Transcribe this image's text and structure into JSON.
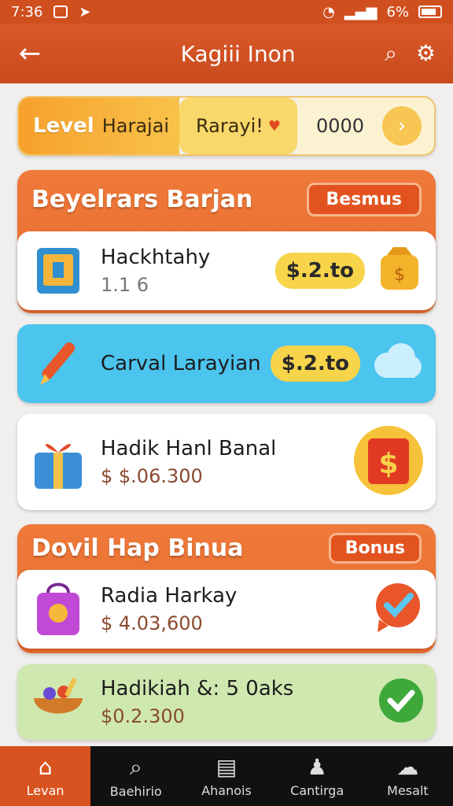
{
  "status_bar": {
    "time": "7:36",
    "battery": "6%"
  },
  "app_bar": {
    "back_icon": "back-arrow",
    "title": "Kagiii Inon",
    "search_icon": "search",
    "settings_icon": "gear"
  },
  "level_bar": {
    "level_label": "Level",
    "level_value": "Harajai",
    "middle_label": "Rarayi!",
    "count": "0000"
  },
  "section1": {
    "title": "Beyelrars Barjan",
    "button_label": "Besmus",
    "rows": [
      {
        "name": "Hackhtahy",
        "sub": "1.1 6",
        "price": "$.2.to"
      },
      {
        "name": "Carval Larayian",
        "price": "$.2.to"
      },
      {
        "name": "Hadik Hanl Banal",
        "sub": "$ $.06.300"
      }
    ]
  },
  "section2": {
    "title": "Dovil Hap Binua",
    "button_label": "Bonus",
    "rows": [
      {
        "name": "Radia Harkay",
        "sub": "$ 4.03,600"
      },
      {
        "name": "Hadikiah &: 5 0aks",
        "sub": "$0.2.300"
      }
    ]
  },
  "bottom_nav": [
    {
      "label": "Levan",
      "icon": "home",
      "active": true
    },
    {
      "label": "Baehirio",
      "icon": "search",
      "active": false
    },
    {
      "label": "Ahanois",
      "icon": "list",
      "active": false
    },
    {
      "label": "Cantirga",
      "icon": "person",
      "active": false
    },
    {
      "label": "Mesalt",
      "icon": "chat",
      "active": false
    }
  ],
  "colors": {
    "primary": "#d9592a",
    "accent_yellow": "#f7d44a",
    "sky_blue": "#4bc4ee",
    "light_green": "#cfe8b0"
  }
}
